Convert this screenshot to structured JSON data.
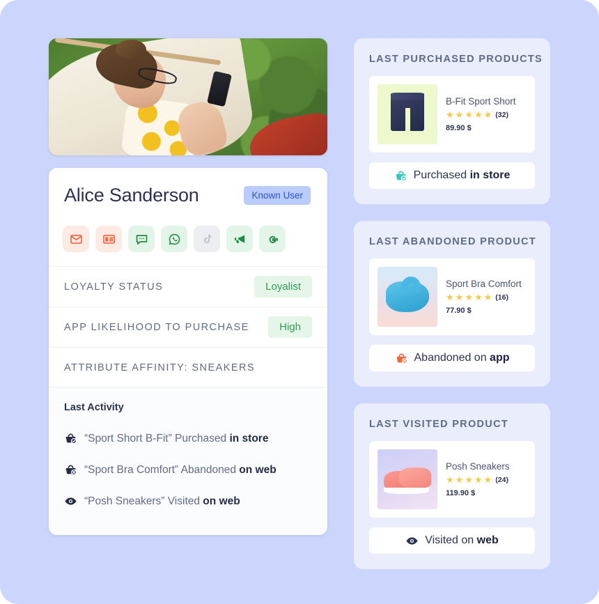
{
  "colors": {
    "page_bg": "#ccd5fb",
    "card_bg": "#ffffff",
    "right_card_bg": "#eaeefc",
    "badge_bg": "#b9ccfb",
    "badge_text": "#2f52d6",
    "pill_bg": "#e5f6e9",
    "pill_text": "#2f9e52",
    "star": "#f7c948",
    "purchased_icon": "#35c8c2",
    "abandoned_icon": "#f4623a",
    "visited_icon": "#2b3352"
  },
  "profile": {
    "hero_image_alt": "woman-in-hammock-using-phone",
    "name": "Alice Sanderson",
    "badge": "Known User",
    "channels": [
      {
        "name": "email-icon",
        "label": "Email",
        "style": "orange",
        "state": "active"
      },
      {
        "name": "newsletter-icon",
        "label": "Newsletter",
        "style": "orange",
        "state": "active"
      },
      {
        "name": "sms-icon",
        "label": "SMS",
        "style": "green",
        "state": "active"
      },
      {
        "name": "whatsapp-icon",
        "label": "WhatsApp",
        "style": "green",
        "state": "active"
      },
      {
        "name": "tiktok-icon",
        "label": "TikTok",
        "style": "gray",
        "state": "inactive"
      },
      {
        "name": "push-icon",
        "label": "Push Notification",
        "style": "green",
        "state": "active"
      },
      {
        "name": "google-icon",
        "label": "Google",
        "style": "green",
        "state": "active"
      }
    ],
    "attributes": [
      {
        "label": "Loyalty Status",
        "value": "Loyalist"
      },
      {
        "label": "App Likelihood to Purchase",
        "value": "High"
      },
      {
        "label": "Attribute Affinity: Sneakers",
        "value": ""
      }
    ],
    "activity_title": "Last Activity",
    "activities": [
      {
        "icon": "basket-check-icon",
        "text": "“Sport Short B-Fit” Purchased ",
        "emphasis": "in store"
      },
      {
        "icon": "basket-x-icon",
        "text": "“Sport Bra Comfort” Abandoned ",
        "emphasis": "on web"
      },
      {
        "icon": "eye-icon",
        "text": "“Posh Sneakers” Visited ",
        "emphasis": "on web"
      }
    ]
  },
  "right_cards": [
    {
      "title": "Last Purchased Products",
      "product": {
        "name": "B-Fit Sport Short",
        "stars": 5,
        "rating_count": "(32)",
        "price": "89.90 $",
        "thumb": "sport-short-thumbnail"
      },
      "footer": {
        "icon": "basket-check-icon",
        "text": "Purchased ",
        "emphasis": "in store"
      }
    },
    {
      "title": "Last Abandoned Product",
      "product": {
        "name": "Sport Bra Comfort",
        "stars": 5,
        "rating_count": "(16)",
        "price": "77.90 $",
        "thumb": "sport-bra-thumbnail"
      },
      "footer": {
        "icon": "basket-x-icon",
        "text": "Abandoned on ",
        "emphasis": "app"
      }
    },
    {
      "title": "Last Visited Product",
      "product": {
        "name": "Posh Sneakers",
        "stars": 5,
        "rating_count": "(24)",
        "price": "119.90 $",
        "thumb": "posh-sneakers-thumbnail"
      },
      "footer": {
        "icon": "eye-icon",
        "text": "Visited on ",
        "emphasis": "web"
      }
    }
  ]
}
